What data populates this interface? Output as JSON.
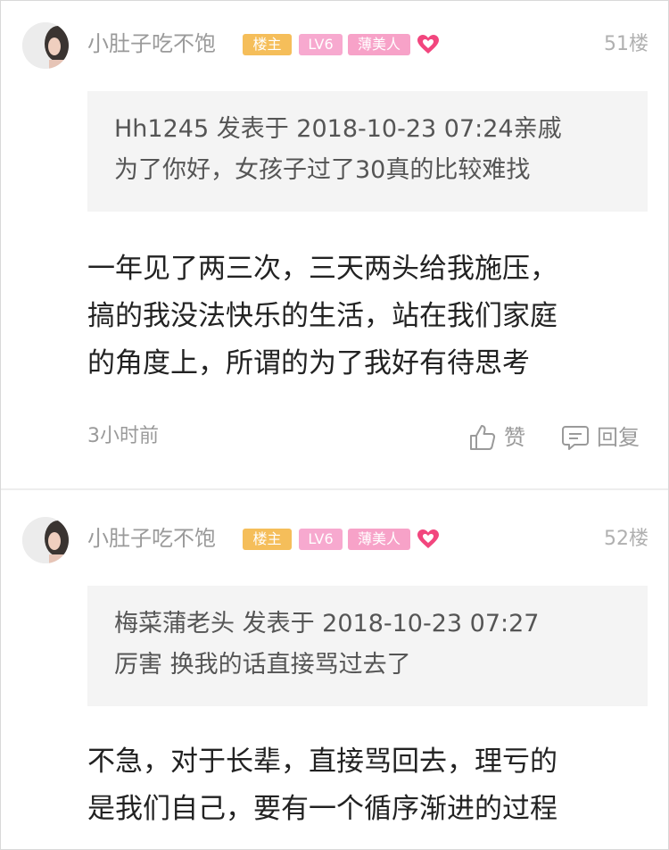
{
  "theme": {
    "badge_owner_color": "#f5be5a",
    "badge_level_color": "#f7a9cf",
    "badge_beauty_color": "#f7a2c8",
    "heart_color": "#f2467e"
  },
  "posts": [
    {
      "username": "小肚子吃不饱",
      "badges": {
        "owner": "楼主",
        "level": "LV6",
        "title": "薄美人"
      },
      "floor": "51楼",
      "quote": {
        "line1": "Hh1245 发表于 2018-10-23 07:24亲戚",
        "line2": "为了你好，女孩子过了30真的比较难找"
      },
      "content": [
        "一年见了两三次，三天两头给我施压，",
        "搞的我没法快乐的生活，站在我们家庭",
        "的角度上，所谓的为了我好有待思考"
      ],
      "time": "3小时前",
      "like_label": "赞",
      "reply_label": "回复"
    },
    {
      "username": "小肚子吃不饱",
      "badges": {
        "owner": "楼主",
        "level": "LV6",
        "title": "薄美人"
      },
      "floor": "52楼",
      "quote": {
        "line1": "梅菜蒲老头 发表于 2018-10-23 07:27",
        "line2": "厉害 换我的话直接骂过去了"
      },
      "content": [
        "不急，对于长辈，直接骂回去，理亏的",
        "是我们自己，要有一个循序渐进的过程"
      ]
    }
  ]
}
